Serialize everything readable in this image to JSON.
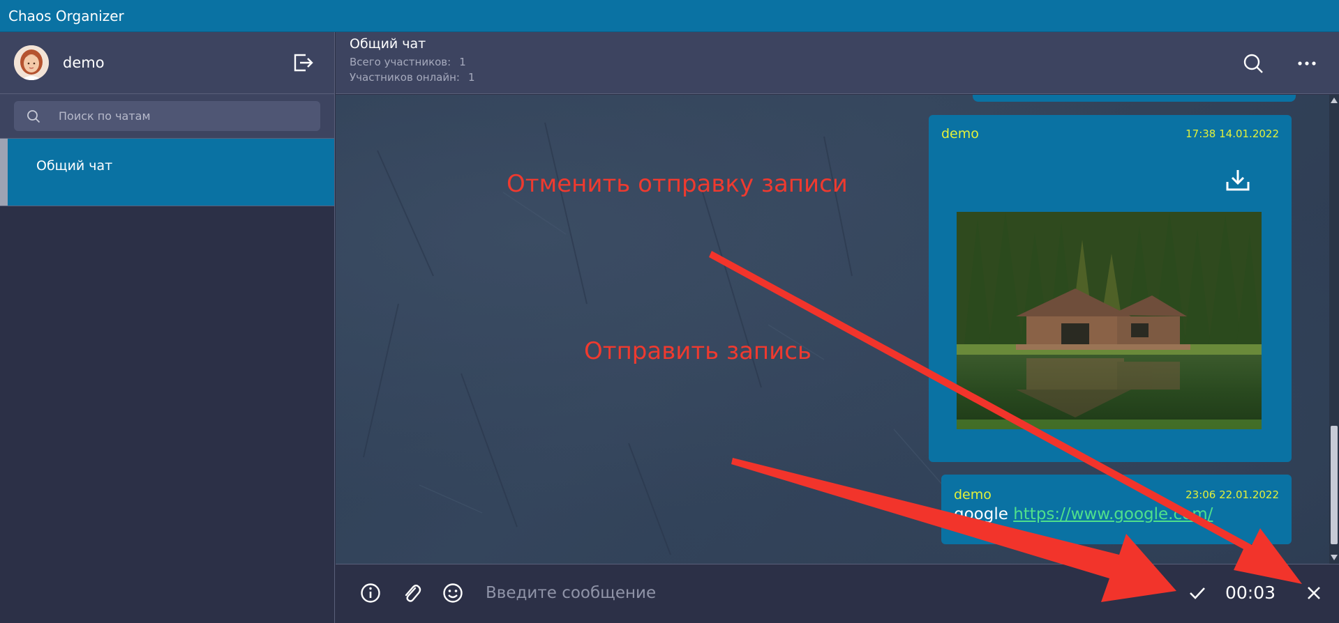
{
  "app": {
    "title": "Chaos Organizer"
  },
  "sidebar": {
    "user": {
      "name": "demo"
    },
    "search": {
      "placeholder": "Поиск по чатам"
    },
    "chats": [
      {
        "label": "Общий чат"
      }
    ]
  },
  "chat": {
    "title": "Общий чат",
    "total_label": "Всего участников:",
    "total_value": "1",
    "online_label": "Участников онлайн:",
    "online_value": "1"
  },
  "messages": [
    {
      "author": "demo",
      "time": "17:38 14.01.2022",
      "type": "image"
    },
    {
      "author": "demo",
      "time": "23:06 22.01.2022",
      "text": "google",
      "link": "https://www.google.com/"
    }
  ],
  "annotations": {
    "cancel": "Отменить отправку записи",
    "send": "Отправить запись"
  },
  "input": {
    "placeholder": "Введите сообщение",
    "timer": "00:03"
  },
  "colors": {
    "accent": "#0a72a3",
    "name_color": "#e3f13a",
    "link_color": "#4fe08c",
    "annotation": "#ef3a2f"
  },
  "icons": [
    "logout-icon",
    "search-icon",
    "more-icon",
    "download-icon",
    "info-icon",
    "paperclip-icon",
    "emoji-icon",
    "check-icon",
    "close-icon"
  ]
}
